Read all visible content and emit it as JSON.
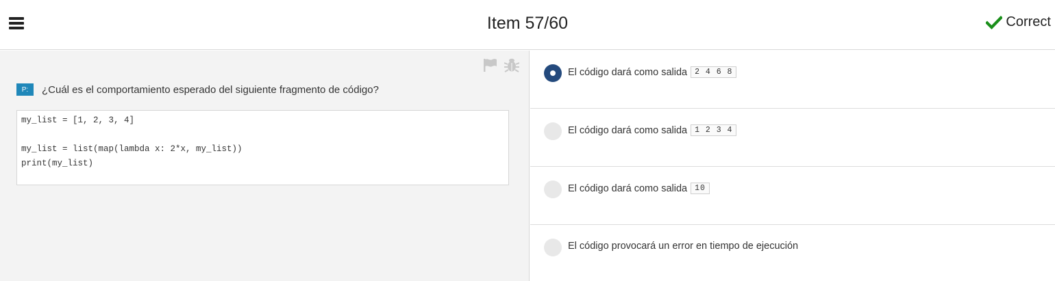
{
  "header": {
    "menu_icon": "hamburger-menu-icon",
    "title": "Item 57/60",
    "status": "Correct",
    "status_icon": "checkmark-icon",
    "status_color": "#1a8f1a"
  },
  "question": {
    "badge": "P:",
    "text": "¿Cuál es el comportamiento esperado del siguiente fragmento de código?",
    "badge_color": "#1f87b9",
    "tools": [
      "flag-icon",
      "bug-icon"
    ],
    "code_lines": [
      "my_list = [1, 2, 3, 4]",
      "",
      "my_list = list(map(lambda x: 2*x, my_list))",
      "print(my_list)"
    ]
  },
  "options": [
    {
      "label": "El código dará como salida",
      "code": "2 4 6 8",
      "selected": true
    },
    {
      "label": "El código dará como salida",
      "code": "1 2 3 4",
      "selected": false
    },
    {
      "label": "El código dará como salida",
      "code": "10",
      "selected": false
    },
    {
      "label": "El código provocará un error en tiempo de ejecución",
      "code": "",
      "selected": false
    }
  ],
  "colors": {
    "selected_radio": "#244a7d",
    "left_panel_bg": "#f3f3f3"
  }
}
